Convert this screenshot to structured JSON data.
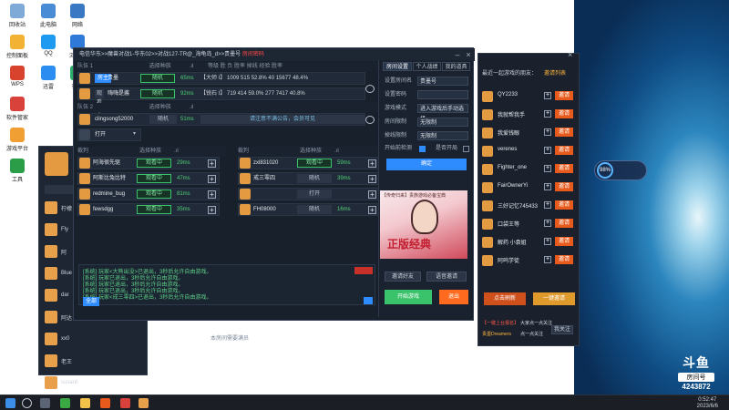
{
  "desktop": {
    "icons": [
      {
        "label": "回收站",
        "color": "#7fa9d6"
      },
      {
        "label": "此电脑",
        "color": "#4a8bd6"
      },
      {
        "label": "网络",
        "color": "#3b78c4"
      },
      {
        "label": "控制面板",
        "color": "#f2b233"
      },
      {
        "label": "QQ",
        "color": "#1e9bf0"
      },
      {
        "label": "浏览器",
        "color": "#2f7ad8"
      },
      {
        "label": "WPS",
        "color": "#d8432e"
      },
      {
        "label": "迅雷",
        "color": "#2c8df0"
      },
      {
        "label": "微信",
        "color": "#2aae67"
      },
      {
        "label": "软件管家",
        "color": "#d9413b"
      },
      {
        "label": "游戏平台",
        "color": "#f0a032"
      },
      {
        "label": "工具",
        "color": "#2b9c48"
      }
    ]
  },
  "taskbar": {
    "time": "0:52:47",
    "date": "2023/6/6"
  },
  "watermark": {
    "logo": "斗鱼",
    "sub": "房间号",
    "room": "4243872"
  },
  "main_window": {
    "title": "电信华东>>魔兽对战1-华东02>>对战127-TR@_海龟岛_d>>贵墨号",
    "title_red": "房间密码",
    "team1_label": "队伍 1",
    "team2_label": "队伍 2",
    "team1_players": [
      {
        "name": "贵墨",
        "tag": "房主",
        "ping": "65ms",
        "stats": "【大师 I】 1009 515 52.8% 40 15677 48.4%"
      },
      {
        "name": "嗨嗨是酱",
        "tag": "观看中",
        "ping": "92ms",
        "stats": "【锐石 I】 719 414 59.0% 277 7417 40.8%"
      }
    ],
    "team2_players": [
      {
        "name": "clingsong52000",
        "tag": "观看中",
        "ping": "51ms",
        "note": "请注意不满公告，会员可见"
      }
    ],
    "open_label": "打开",
    "left_team_label": "裁判",
    "right_team_label": "裁判",
    "left_slots": [
      {
        "name": "阿海很先驱",
        "tag": "观看中",
        "ping": "29ms"
      },
      {
        "name": "阿斯比兔比特",
        "tag": "观看中",
        "ping": "47ms"
      },
      {
        "name": "redmine_bug",
        "tag": "观看中",
        "ping": "81ms"
      },
      {
        "name": "fewsdgg",
        "tag": "观看中",
        "ping": "35ms"
      }
    ],
    "right_slots": [
      {
        "name": "zxl831020",
        "tag": "观看中",
        "ping": "59ms"
      },
      {
        "name": "戒三零四",
        "tag": "随机",
        "ping": "39ms"
      },
      {
        "name": "",
        "tag": "打开",
        "ping": ""
      },
      {
        "name": "FH08000",
        "tag": "随机",
        "ping": "16ms"
      }
    ],
    "chat_lines": [
      "[系统] 玩家<大熊出没>已退出，3秒后允许自由游戏。",
      "[系统] 玩家已退出，3秒后允许自由游戏。",
      "[系统] 玩家已退出，3秒后允许自由游戏。",
      "[系统] 玩家已退出，3秒后允许自由游戏。",
      "[系统] 玩家<戒三零四>已退出，3秒后允许自由游戏。"
    ],
    "chat_badge": "全部",
    "bottom_hint": "本房间需要满员"
  },
  "settings": {
    "tabs": [
      "房间设置",
      "个人战绩",
      "我的道具"
    ],
    "rows": [
      {
        "label": "设置房间名",
        "value": "贵墨号"
      },
      {
        "label": "设置密码",
        "value": ""
      },
      {
        "label": "游戏模式",
        "value": "进入游戏后手动选择"
      },
      {
        "label": "房间限制",
        "value": "无限制"
      },
      {
        "label": "掉线限制",
        "value": "无限制"
      }
    ],
    "check_label": "开始前检测",
    "check_label2": "是否开局",
    "confirm": "确定",
    "ad_caption": "【传奇归来】贵族游戏必备宝典",
    "ad_title": "正版经典",
    "btn_invite_room": "邀请好友",
    "btn_voice": "语音邀请",
    "btn_start": "开始游戏",
    "btn_exit": "退出"
  },
  "invite": {
    "header": "最近一起游戏的朋友：",
    "header_link": "邀请列表",
    "friends": [
      "QY2233",
      "我就帮我手",
      "我爱钱眼",
      "verenes",
      "Fighter_one",
      "FairOwnerYi",
      "三好记忆745433",
      "口袋王等",
      "解药 小袁姐",
      "阿呜学徒"
    ],
    "invite_label": "邀请",
    "btn_refresh": "点击刷新",
    "btn_invite_all": "一键邀请",
    "footer1": "【一键上台报名】",
    "footer2": "大家点一点关注",
    "footer3": "贵墨Dreamers",
    "footer4": "点一点关注",
    "footer_btn": "我关注"
  },
  "left_panel": {
    "friends": [
      "柠檬",
      "Fly",
      "阿",
      "Blue",
      "dar",
      "阿达",
      "xx0",
      "老王",
      "susanli"
    ]
  },
  "ping_widget": {
    "value": "98%"
  }
}
